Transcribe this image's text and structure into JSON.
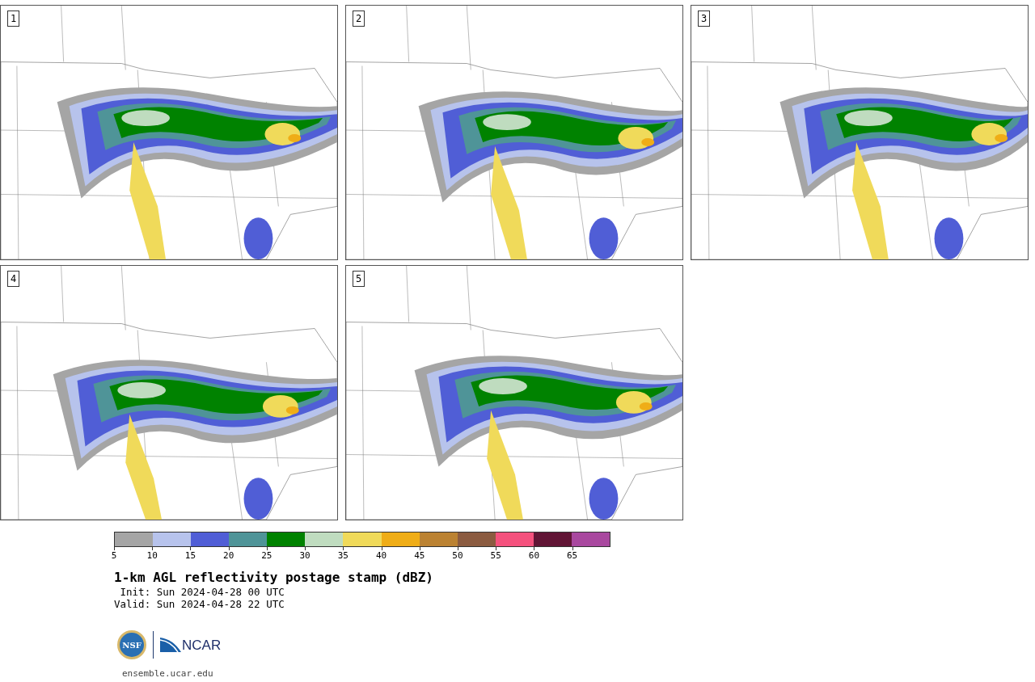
{
  "panels": [
    {
      "label": "1"
    },
    {
      "label": "2"
    },
    {
      "label": "3"
    },
    {
      "label": "4"
    },
    {
      "label": "5"
    }
  ],
  "colorbar": {
    "segments": [
      {
        "color": "#a5a5a5"
      },
      {
        "color": "#b7c3ec"
      },
      {
        "color": "#505ed6"
      },
      {
        "color": "#4f9498"
      },
      {
        "color": "#008200"
      },
      {
        "color": "#bfdcbf"
      },
      {
        "color": "#f0da5a"
      },
      {
        "color": "#efad17"
      },
      {
        "color": "#bb8232"
      },
      {
        "color": "#8b5b40"
      },
      {
        "color": "#f4517d"
      },
      {
        "color": "#611535"
      },
      {
        "color": "#a9489f"
      }
    ],
    "ticks": [
      "5",
      "10",
      "15",
      "20",
      "25",
      "30",
      "35",
      "40",
      "45",
      "50",
      "55",
      "60",
      "65"
    ]
  },
  "title": "1-km AGL reflectivity postage stamp (dBZ)",
  "init": " Init: Sun 2024-04-28 00 UTC",
  "valid": "Valid: Sun 2024-04-28 22 UTC",
  "logos": {
    "nsf": "NSF",
    "ncar": "NCAR"
  },
  "url": "ensemble.ucar.edu"
}
